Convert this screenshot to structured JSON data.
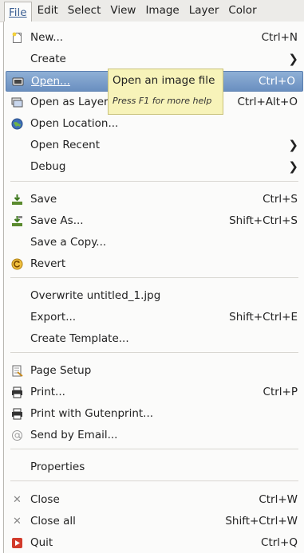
{
  "menubar": {
    "items": [
      {
        "label": "File"
      },
      {
        "label": "Edit"
      },
      {
        "label": "Select"
      },
      {
        "label": "View"
      },
      {
        "label": "Image"
      },
      {
        "label": "Layer"
      },
      {
        "label": "Color"
      }
    ]
  },
  "file_menu": {
    "new": {
      "label": "New...",
      "accel": "Ctrl+N",
      "icon": "new-document-icon"
    },
    "create": {
      "label": "Create",
      "icon": "submenu-arrow"
    },
    "open": {
      "label": "Open...",
      "accel": "Ctrl+O",
      "icon": "open-folder-icon"
    },
    "open_as_layers": {
      "label": "Open as Layers...",
      "accel": "Ctrl+Alt+O",
      "icon": "open-as-layers-icon"
    },
    "open_location": {
      "label": "Open Location...",
      "icon": "globe-icon"
    },
    "open_recent": {
      "label": "Open Recent"
    },
    "debug": {
      "label": "Debug"
    },
    "save": {
      "label": "Save",
      "accel": "Ctrl+S",
      "icon": "save-icon"
    },
    "save_as": {
      "label": "Save As...",
      "accel": "Shift+Ctrl+S",
      "icon": "save-as-icon"
    },
    "save_copy": {
      "label": "Save a Copy..."
    },
    "revert": {
      "label": "Revert",
      "icon": "revert-icon"
    },
    "overwrite": {
      "label": "Overwrite untitled_1.jpg"
    },
    "export": {
      "label": "Export...",
      "accel": "Shift+Ctrl+E"
    },
    "create_template": {
      "label": "Create Template..."
    },
    "page_setup": {
      "label": "Page Setup",
      "icon": "page-setup-icon"
    },
    "print": {
      "label": "Print...",
      "accel": "Ctrl+P",
      "icon": "printer-icon"
    },
    "print_gutenprint": {
      "label": "Print with Gutenprint...",
      "icon": "printer-icon"
    },
    "send_email": {
      "label": "Send by Email...",
      "icon": "email-icon"
    },
    "properties": {
      "label": "Properties"
    },
    "close": {
      "label": "Close",
      "accel": "Ctrl+W",
      "icon": "close-x-icon"
    },
    "close_all": {
      "label": "Close all",
      "accel": "Shift+Ctrl+W",
      "icon": "close-x-icon"
    },
    "quit": {
      "label": "Quit",
      "accel": "Ctrl+Q",
      "icon": "quit-icon"
    }
  },
  "tooltip": {
    "title": "Open an image file",
    "help": "Press F1 for more help"
  },
  "colors": {
    "highlight": "#6a8fc0",
    "tooltip_bg": "#f7f3b9",
    "menu_bg": "#fbfbfa"
  }
}
